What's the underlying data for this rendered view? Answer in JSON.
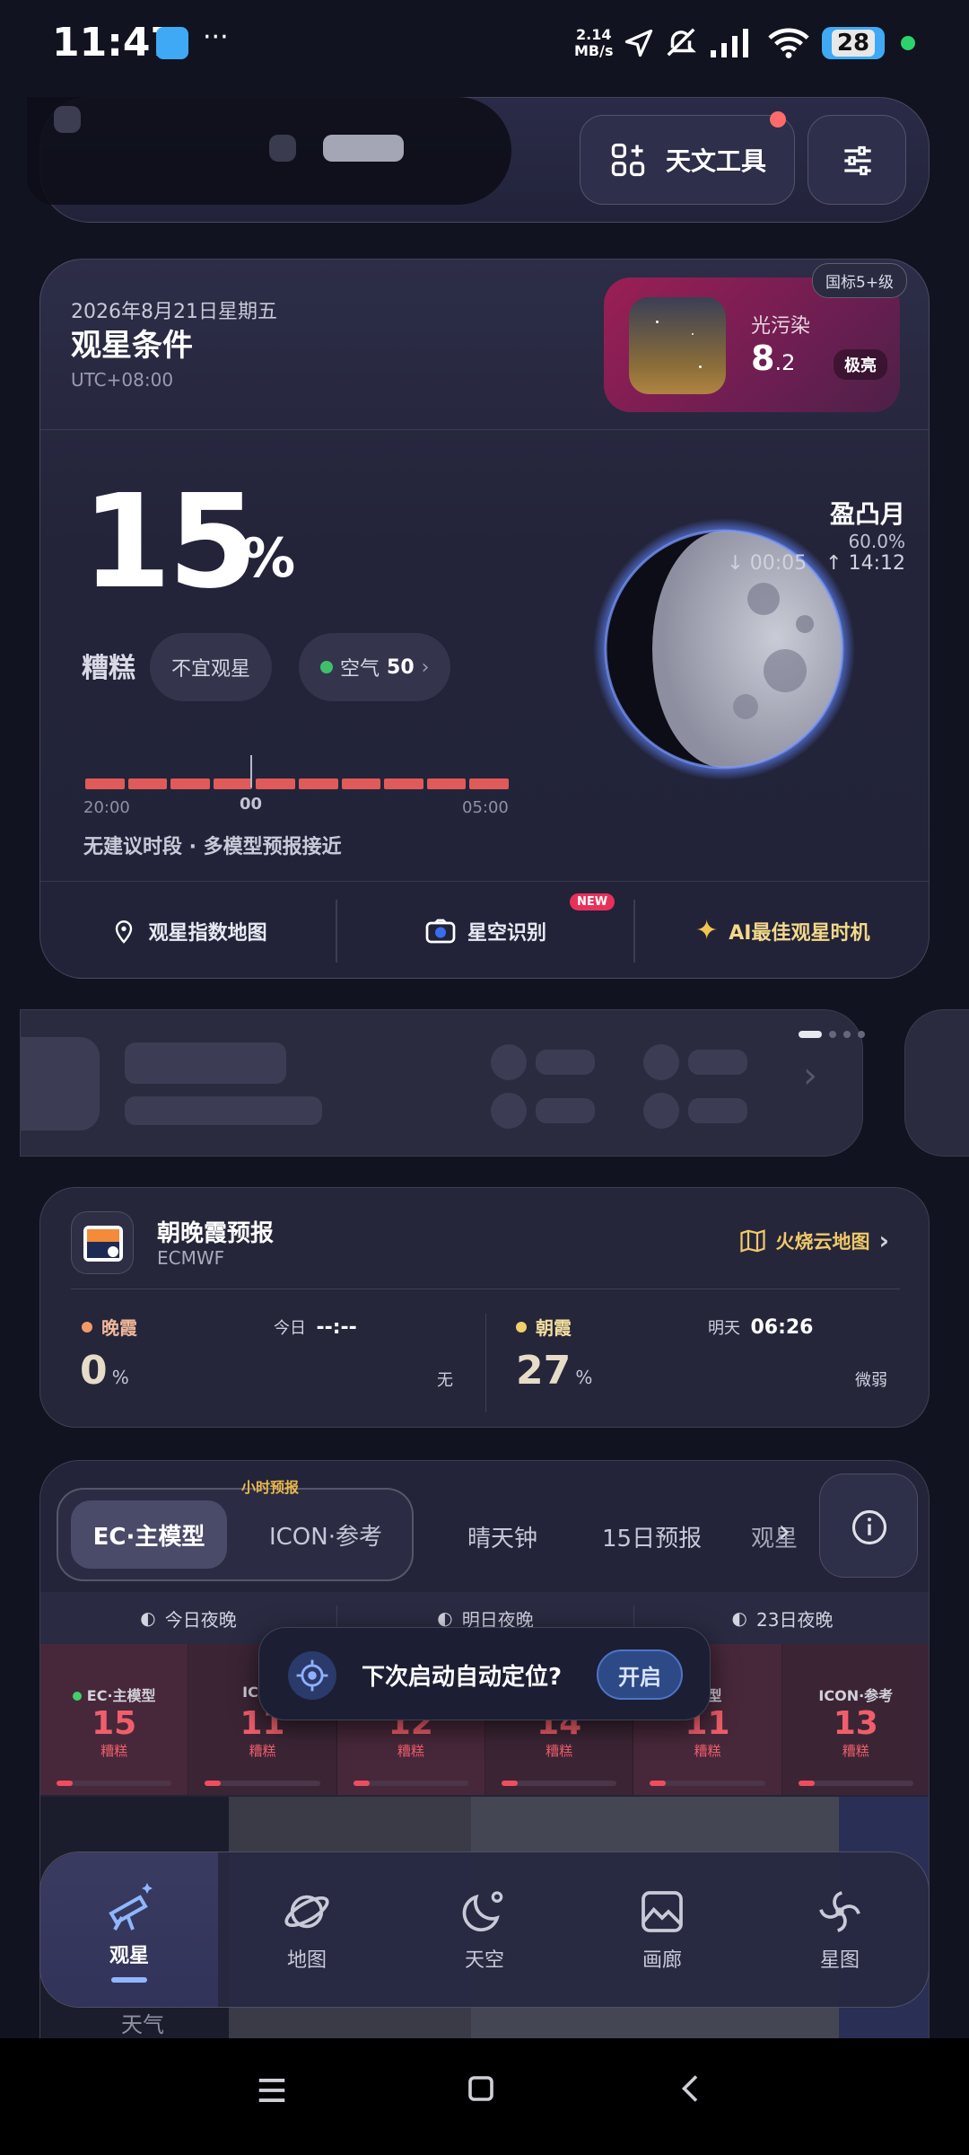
{
  "status_bar": {
    "time": "11:47",
    "speed_value": "2.14",
    "speed_unit": "MB/s",
    "battery": "28"
  },
  "header": {
    "tools_label": "天文工具"
  },
  "conditions": {
    "date": "2026年8月21日星期五",
    "title": "观星条件",
    "timezone": "UTC+08:00",
    "light_pollution_label": "光污染",
    "light_pollution_int": "8",
    "light_pollution_dec": ".2",
    "light_pollution_level": "极亮",
    "intl_badge": "国标5+级",
    "percent": "15",
    "percent_sign": "%",
    "grade": "糟糕",
    "advice": "不宜观星",
    "air_label": "空气",
    "air_value": "50",
    "axis_start": "20:00",
    "axis_mid": "00",
    "axis_end": "05:00",
    "note": "无建议时段 · 多模型预报接近",
    "moon_phase": "盈凸月",
    "moon_illum": "60.0%",
    "moonset": "00:05",
    "moonrise": "14:12",
    "timeline_level": 0.15,
    "links": [
      "观星指数地图",
      "星空识别",
      "AI最佳观星时机"
    ],
    "new_badge": "NEW"
  },
  "sunset_card": {
    "title": "朝晚霞预报",
    "model": "ECMWF",
    "map_link": "火烧云地图",
    "evening_label": "晚霞",
    "evening_day": "今日",
    "evening_time": "--:--",
    "evening_value": "0",
    "evening_unit": "%",
    "evening_level": "无",
    "morning_label": "朝霞",
    "morning_day": "明天",
    "morning_time": "06:26",
    "morning_value": "27",
    "morning_unit": "%",
    "morning_level": "微弱"
  },
  "forecast": {
    "hourly_badge": "小时预报",
    "seg_active": "EC·主模型",
    "seg_other": "ICON·参考",
    "tabs": [
      "晴天钟",
      "15日预报",
      "观星"
    ],
    "nights": [
      "今日夜晚",
      "明日夜晚",
      "23日夜晚"
    ],
    "cells": [
      {
        "model": "EC·主模型",
        "value": "15",
        "grade": "糟糕"
      },
      {
        "model": "ICON",
        "value": "11",
        "grade": "糟糕"
      },
      {
        "model": "",
        "value": "12",
        "grade": "糟糕"
      },
      {
        "model": "",
        "value": "14",
        "grade": "糟糕"
      },
      {
        "model": "模型",
        "value": "11",
        "grade": "糟糕"
      },
      {
        "model": "ICON·参考",
        "value": "13",
        "grade": "糟糕"
      }
    ],
    "weather_label": "天气"
  },
  "toast": {
    "text": "下次启动自动定位?",
    "button": "开启"
  },
  "bottom_nav": [
    "观星",
    "地图",
    "天空",
    "画廊",
    "星图"
  ],
  "colors": {
    "accent_red": "#e05a5a",
    "gold": "#f0c868",
    "light_pollution_bg": "#9b1f55",
    "nav_indicator": "#8fb7ff"
  }
}
